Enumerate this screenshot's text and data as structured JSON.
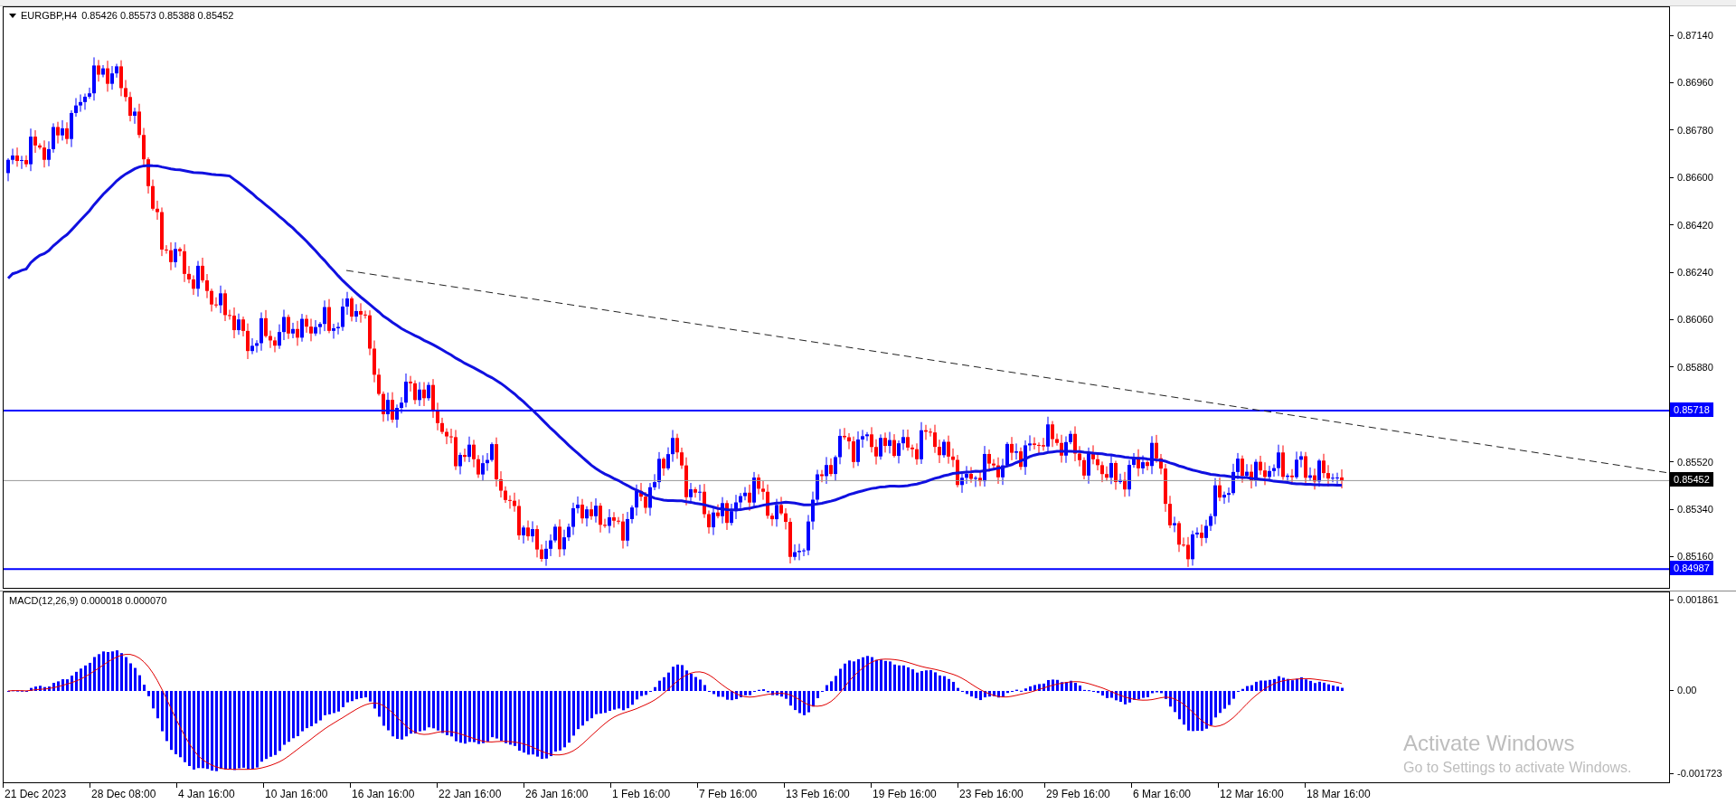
{
  "chart": {
    "symbol": "EURGBP,H4",
    "ohlc": "0.85426 0.85573 0.85388 0.85452"
  },
  "price_axis": [
    "0.87140",
    "0.86960",
    "0.86780",
    "0.86600",
    "0.86420",
    "0.86240",
    "0.86060",
    "0.85880",
    "0.85520",
    "0.85340",
    "0.85160"
  ],
  "price_lines": [
    {
      "kind": "resistance",
      "label": "0.85718"
    },
    {
      "kind": "current",
      "label": "0.85452"
    },
    {
      "kind": "support",
      "label": "0.84987"
    }
  ],
  "indicator": {
    "label": "MACD(12,26,9) 0.000018 0.000070",
    "axis": [
      "0.001861",
      "0.00",
      "-0.001723"
    ]
  },
  "time_axis": [
    "21 Dec 2023",
    "28 Dec 08:00",
    "4 Jan 16:00",
    "10 Jan 16:00",
    "16 Jan 16:00",
    "22 Jan 16:00",
    "26 Jan 16:00",
    "1 Feb 16:00",
    "7 Feb 16:00",
    "13 Feb 16:00",
    "19 Feb 16:00",
    "23 Feb 16:00",
    "29 Feb 16:00",
    "6 Mar 16:00",
    "12 Mar 16:00",
    "18 Mar 16:00"
  ],
  "watermark": {
    "title": "Activate Windows",
    "text": "Go to Settings to activate Windows."
  }
}
